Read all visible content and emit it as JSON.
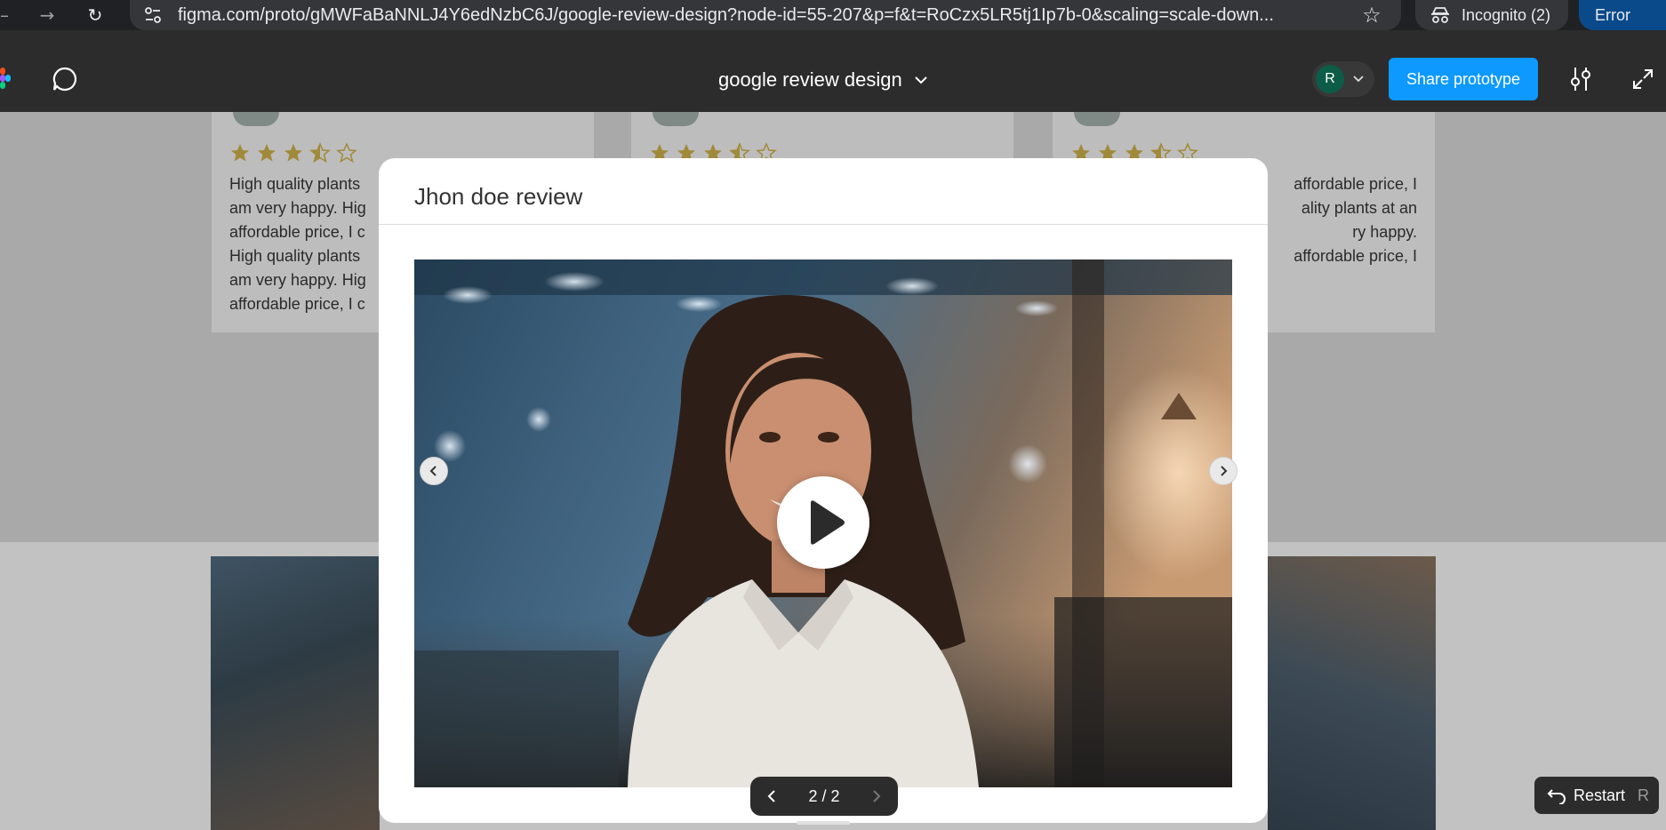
{
  "browser": {
    "url": "figma.com/proto/gMWFaBaNNLJ4Y6edNzbC6J/google-review-design?node-id=55-207&p=f&t=RoCzx5LR5tj1Ip7b-0&scaling=scale-down...",
    "incognito_label": "Incognito (2)",
    "error_label": "Error"
  },
  "figma": {
    "file_title": "google review design",
    "avatar_initial": "R",
    "share_label": "Share prototype"
  },
  "review_cards": [
    {
      "text": "High quality plants at an affordable price, I am very happy. High quality plants at an affordable price, I am very happy. High quality plants at an affordable price, I am very happy. High quality plants at an affordable price, I",
      "rating": 3.5
    },
    {
      "text": "",
      "rating": 3.5
    },
    {
      "text": "affordable price, I quality plants at an very happy. affordable price, I",
      "rating": 3.5
    }
  ],
  "review_card_left_lines": [
    "High quality plants",
    "am very happy. Hig",
    "affordable price, I c",
    "High quality plants",
    "am very happy. Hig",
    "affordable price, I c"
  ],
  "review_card_right_lines": [
    "affordable price, I",
    "ality plants at an",
    "ry happy.",
    "affordable price, I"
  ],
  "modal": {
    "title": "Jhon doe review",
    "video_label": "Video review"
  },
  "pager": {
    "count": "2 / 2"
  },
  "restart": {
    "label": "Restart",
    "shortcut": "R"
  },
  "colors": {
    "share_blue": "#0d99ff",
    "star_gold": "#c9a227",
    "toolbar": "#2c2c2c"
  }
}
